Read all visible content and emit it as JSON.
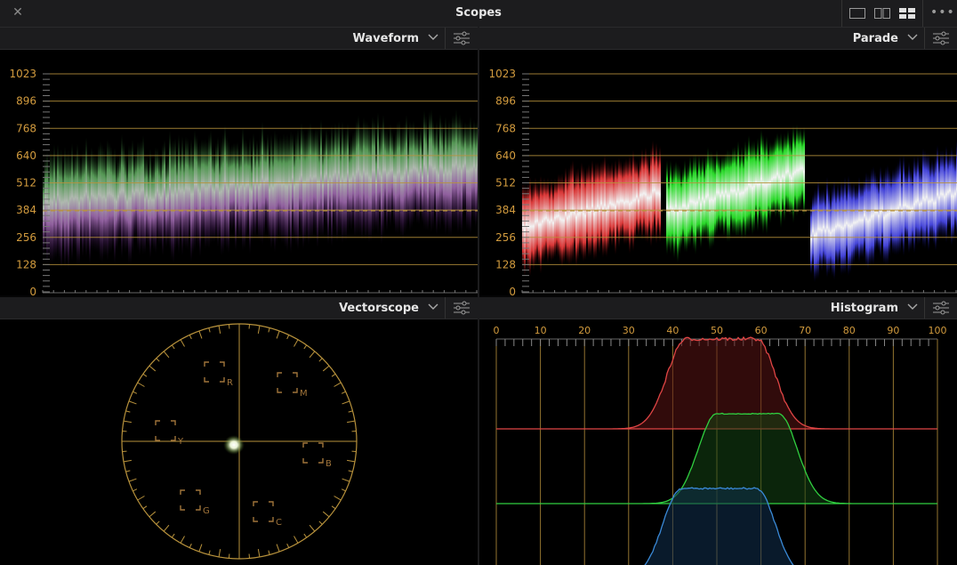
{
  "window": {
    "title": "Scopes",
    "close_icon": "close-icon",
    "layout_icons": [
      "single-view-icon",
      "dual-view-icon",
      "quad-view-icon"
    ],
    "more_icon": "more-options-icon"
  },
  "colors": {
    "accent_line": "#b8923c",
    "tick_label": "#d29b3e",
    "panel_bg": "#000000",
    "header_bg": "#1c1c1e"
  },
  "panels": {
    "waveform": {
      "title": "Waveform",
      "scale": [
        "1023",
        "896",
        "768",
        "640",
        "512",
        "384",
        "256",
        "128",
        "0"
      ]
    },
    "parade": {
      "title": "Parade",
      "scale": [
        "1023",
        "896",
        "768",
        "640",
        "512",
        "384",
        "256",
        "128",
        "0"
      ]
    },
    "vectorscope": {
      "title": "Vectorscope",
      "targets": [
        "R",
        "M",
        "Y",
        "B",
        "G",
        "C"
      ]
    },
    "histogram": {
      "title": "Histogram",
      "scale": [
        "0",
        "10",
        "20",
        "30",
        "40",
        "50",
        "60",
        "70",
        "80",
        "90",
        "100"
      ]
    }
  }
}
